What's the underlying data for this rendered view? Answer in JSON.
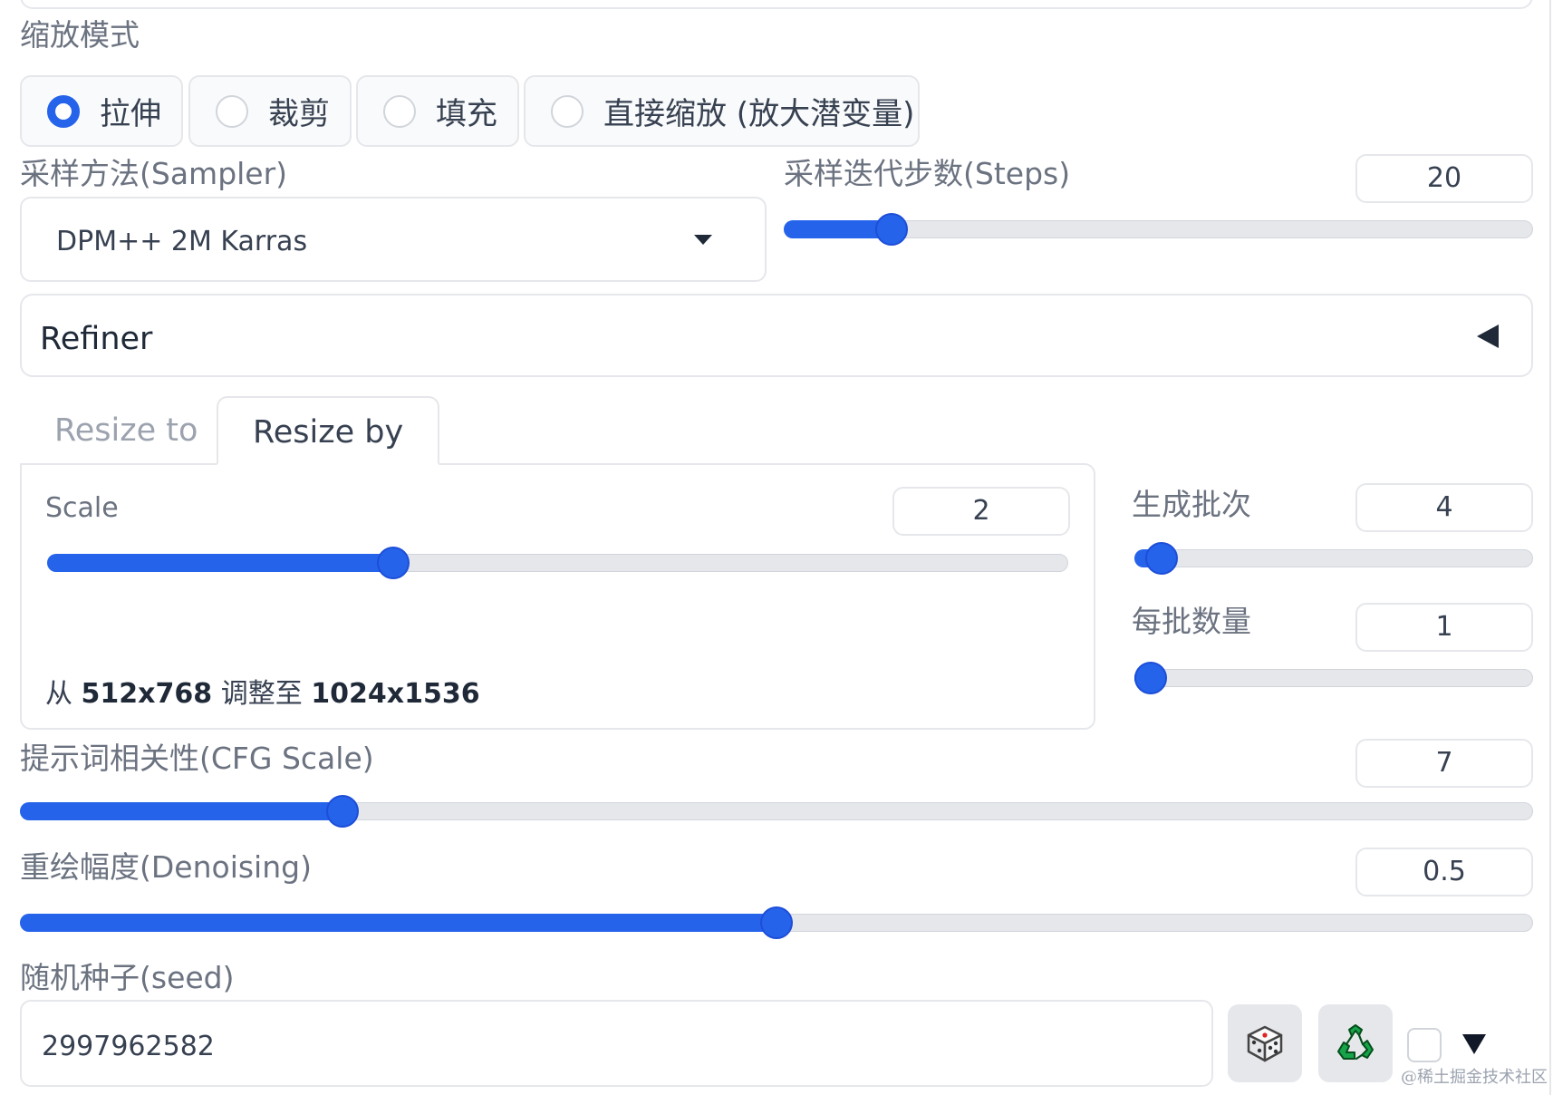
{
  "resize_mode": {
    "label": "缩放模式",
    "options": [
      "拉伸",
      "裁剪",
      "填充",
      "直接缩放 (放大潜变量)"
    ],
    "selected_index": 0
  },
  "sampler": {
    "label": "采样方法(Sampler)",
    "value": "DPM++ 2M Karras"
  },
  "steps": {
    "label": "采样迭代步数(Steps)",
    "value": "20",
    "min": 1,
    "max": 150
  },
  "refiner": {
    "title": "Refiner"
  },
  "tabs": [
    {
      "label": "Resize to",
      "active": false
    },
    {
      "label": "Resize by",
      "active": true
    }
  ],
  "scale": {
    "label": "Scale",
    "value": "2",
    "min": 1,
    "max": 4
  },
  "resize_info": {
    "prefix": "从",
    "from": "512x768",
    "middle": "调整至",
    "to": "1024x1536"
  },
  "batch_count": {
    "label": "生成批次",
    "value": "4",
    "min": 1,
    "max": 100
  },
  "batch_size": {
    "label": "每批数量",
    "value": "1",
    "min": 1,
    "max": 8
  },
  "cfg_scale": {
    "label": "提示词相关性(CFG Scale)",
    "value": "7",
    "min": 1,
    "max": 30
  },
  "denoising": {
    "label": "重绘幅度(Denoising)",
    "value": "0.5",
    "min": 0,
    "max": 1
  },
  "seed": {
    "label": "随机种子(seed)",
    "value": "2997962582"
  },
  "watermark": "@稀土掘金技术社区",
  "colors": {
    "accent": "#2563eb",
    "border": "#e5e7eb",
    "label": "#6b7280"
  }
}
